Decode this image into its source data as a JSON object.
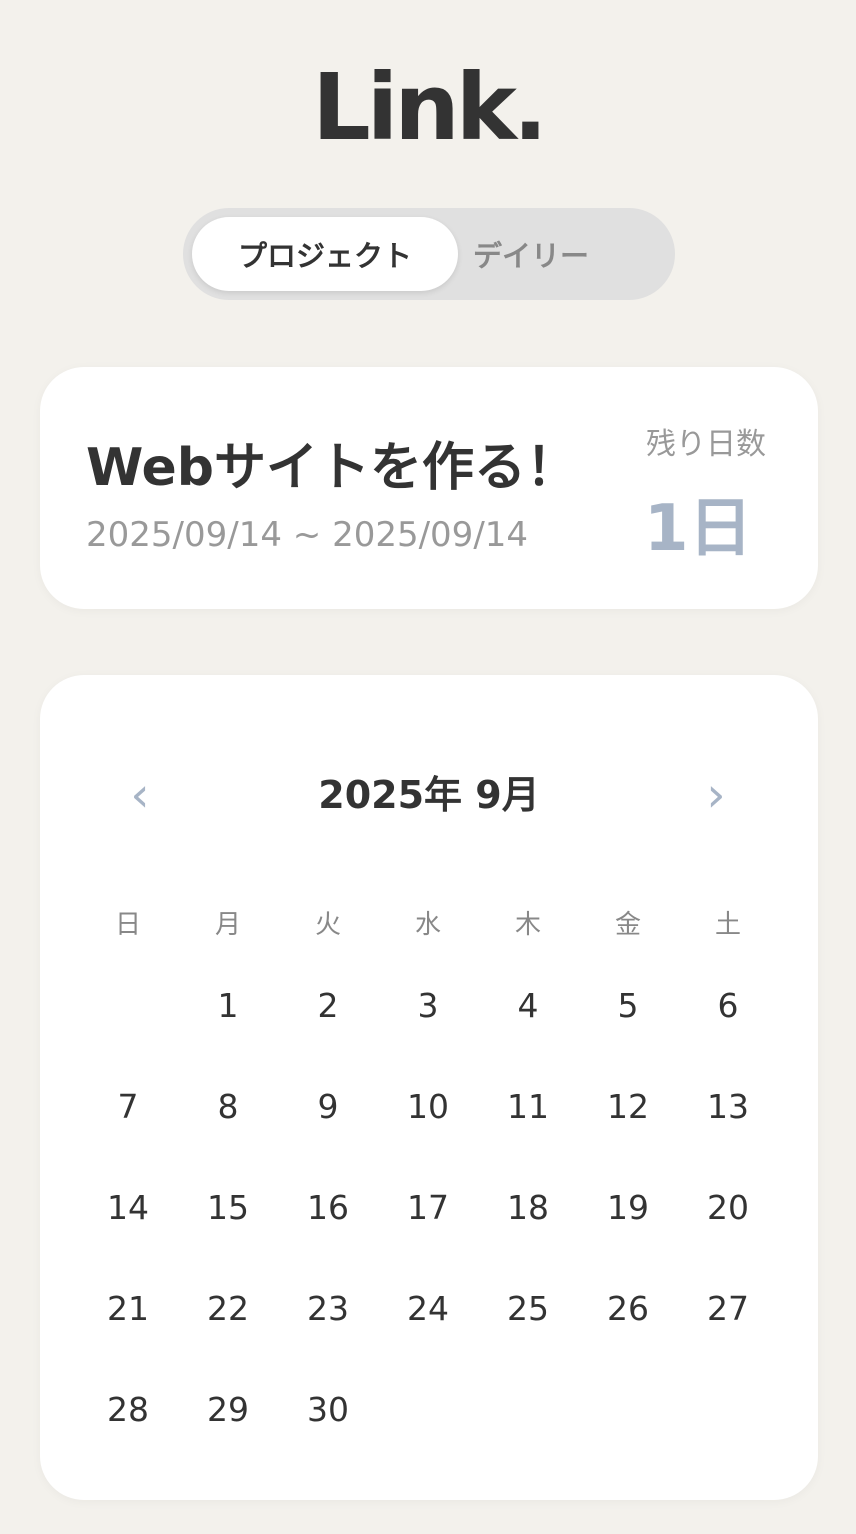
{
  "app": {
    "logo": "Link."
  },
  "tabs": [
    {
      "label": "プロジェクト",
      "active": true
    },
    {
      "label": "デイリー",
      "active": false
    }
  ],
  "project": {
    "title": "Webサイトを作る！",
    "dates": "2025/09/14 ~ 2025/09/14",
    "remaining_label": "残り日数",
    "remaining_value": "1日"
  },
  "calendar": {
    "title": "2025年 9月",
    "prev_icon": "‹",
    "next_icon": "›",
    "weekdays": [
      "日",
      "月",
      "火",
      "水",
      "木",
      "金",
      "土"
    ],
    "days": [
      "",
      "1",
      "2",
      "3",
      "4",
      "5",
      "6",
      "7",
      "8",
      "9",
      "10",
      "11",
      "12",
      "13",
      "14",
      "15",
      "16",
      "17",
      "18",
      "19",
      "20",
      "21",
      "22",
      "23",
      "24",
      "25",
      "26",
      "27",
      "28",
      "29",
      "30"
    ]
  },
  "colors": {
    "background": "#f3f1ec",
    "card": "#ffffff",
    "accent": "#a7b4c6",
    "text": "#333333",
    "muted": "#999999"
  }
}
